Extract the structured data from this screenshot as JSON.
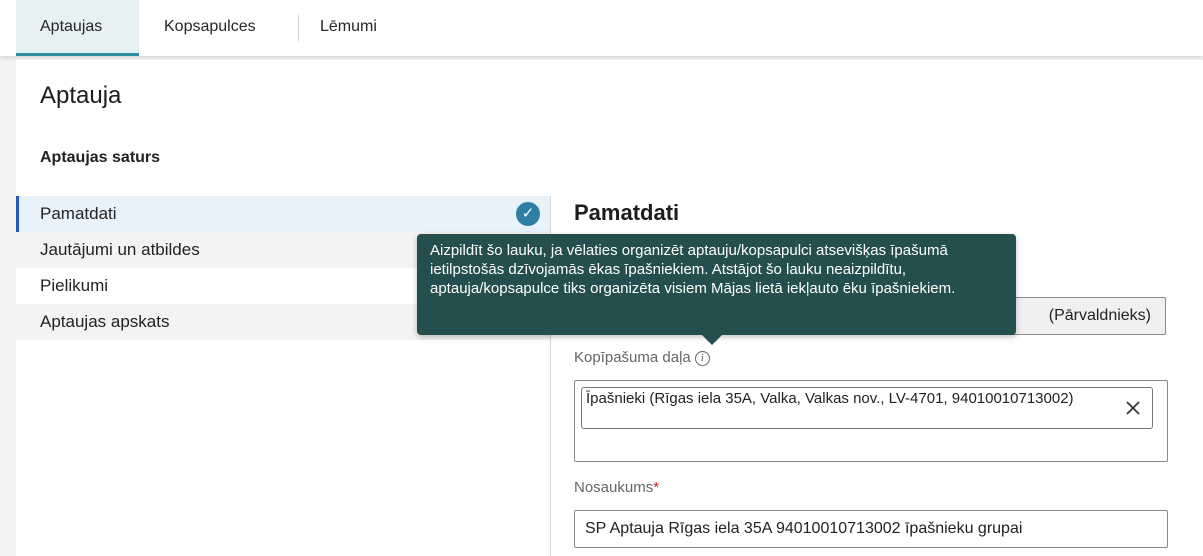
{
  "tabs": [
    {
      "label": "Aptaujas",
      "active": true
    },
    {
      "label": "Kopsapulces",
      "active": false
    },
    {
      "label": "Lēmumi",
      "active": false
    }
  ],
  "page": {
    "title": "Aptauja",
    "section_title": "Aptaujas saturs"
  },
  "nav": {
    "items": [
      {
        "label": "Pamatdati",
        "completed": true
      },
      {
        "label": "Jautājumi un atbildes"
      },
      {
        "label": "Pielikumi"
      },
      {
        "label": "Aptaujas apskats"
      }
    ]
  },
  "form": {
    "title": "Pamatdati",
    "readonly_value_partial": "(Pārvaldnieks)",
    "ownership_label": "Kopīpašuma daļa",
    "ownership_chip": "Īpašnieki (Rīgas iela 35A, Valka, Valkas nov., LV-4701, 94010010713002)",
    "name_label": "Nosaukums",
    "name_required_mark": "*",
    "name_value": "SP Aptauja Rīgas iela 35A 94010010713002 īpašnieku grupai"
  },
  "tooltip": {
    "text": "Aizpildīt šo lauku, ja vēlaties organizēt aptauju/kopsapulci atsevišķas īpašumā ietilpstošās dzīvojamās ēkas īpašniekiem. Atstājot šo lauku neaizpildītu, aptauja/kopsapulce tiks organizēta visiem Mājas lietā iekļauto ēku īpašniekiem."
  },
  "icons": {
    "check": "check-circle-icon",
    "info": "info-icon",
    "close": "close-icon"
  },
  "colors": {
    "accent": "#2b8fa0",
    "nav_active_border": "#2b5bb8",
    "check_bg": "#2f7fa5",
    "tooltip_bg": "#244f4e",
    "required": "#c3252a"
  }
}
